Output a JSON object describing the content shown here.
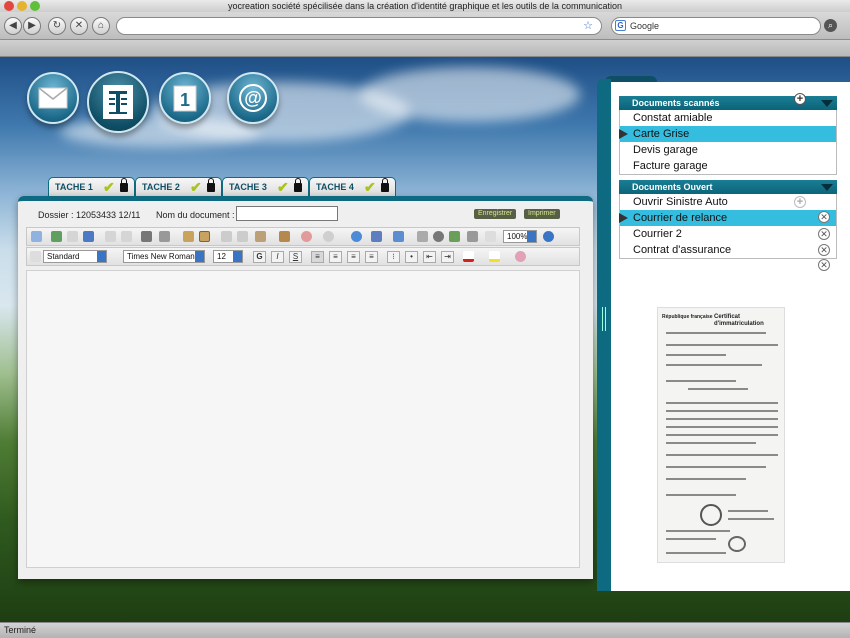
{
  "browser": {
    "window_title": "yocreation société spécilisée dans la création d'identité graphique et les outils de la communication",
    "url": "",
    "search_engine": "Google",
    "status_text": "Terminé"
  },
  "tasks": [
    {
      "label": "TACHE 1"
    },
    {
      "label": "TACHE 2"
    },
    {
      "label": "TACHE 3"
    },
    {
      "label": "TACHE 4"
    }
  ],
  "document": {
    "dossier": "Dossier : 12053433 12/11",
    "name_label": "Nom du document :",
    "name_value": "",
    "save_label": "Enregistrer",
    "print_label": "Imprimer"
  },
  "editor": {
    "style": "Standard",
    "font": "Times New Roman",
    "size": "12",
    "zoom": "100%",
    "bold": "G",
    "italic": "I",
    "underline": "S"
  },
  "scanned_docs": {
    "title": "Documents scannés",
    "items": [
      "Constat amiable",
      "Carte Grise",
      "Devis garage",
      "Facture garage"
    ],
    "selected_index": 1
  },
  "open_docs": {
    "title": "Documents Ouvert",
    "items": [
      "Ouvrir Sinistre Auto",
      "Courrier de relance",
      "Courrier 2",
      "Contrat d'assurance"
    ],
    "selected_index": 1
  },
  "scan_preview": {
    "header_left": "République française",
    "header_right": "Certificat d'immatriculation"
  },
  "colors": {
    "accent": "#0e6a80",
    "selection": "#35bde0",
    "check": "#a8c41b"
  }
}
